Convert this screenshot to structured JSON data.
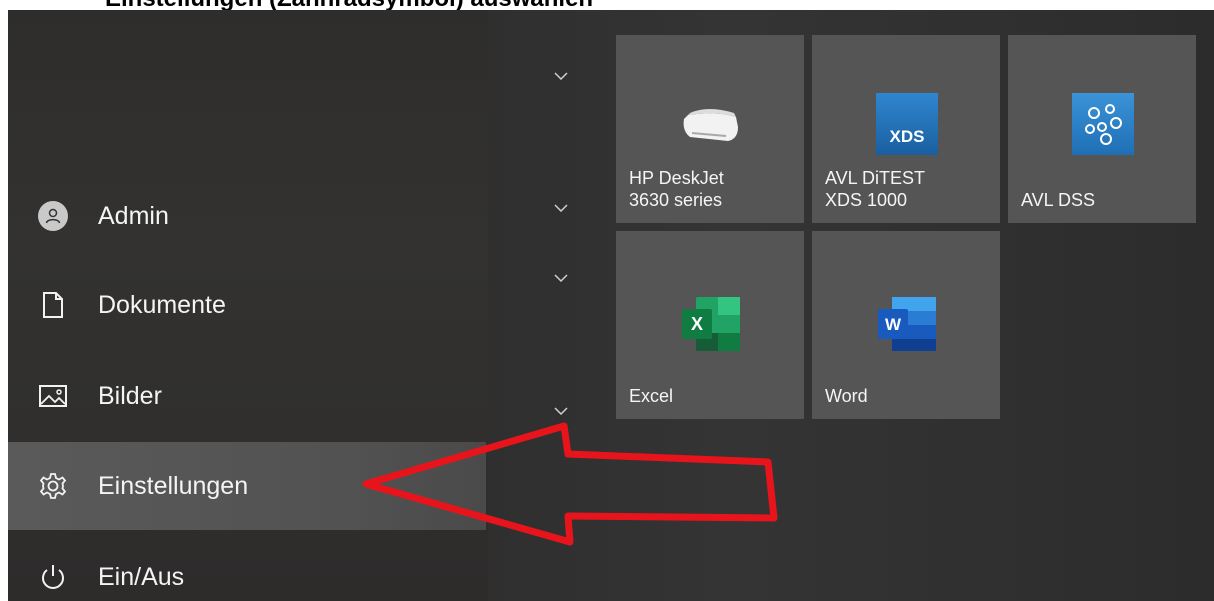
{
  "caption": "Einstellungen (Zahnradsymbol) auswählen",
  "menu": {
    "items": [
      {
        "label": "Admin",
        "icon": "user-avatar-icon"
      },
      {
        "label": "Dokumente",
        "icon": "document-icon"
      },
      {
        "label": "Bilder",
        "icon": "pictures-icon"
      },
      {
        "label": "Einstellungen",
        "icon": "gear-icon",
        "highlighted": true
      },
      {
        "label": "Ein/Aus",
        "icon": "power-icon"
      }
    ]
  },
  "tiles": [
    {
      "label": "HP DeskJet\n3630 series",
      "icon": "printer-icon"
    },
    {
      "label": "AVL DiTEST\nXDS 1000",
      "icon": "xds-logo-icon",
      "icon_text": "XDS"
    },
    {
      "label": "AVL DSS",
      "icon": "avl-dss-logo-icon"
    },
    {
      "label": "Excel",
      "icon": "excel-icon",
      "icon_text": "X"
    },
    {
      "label": "Word",
      "icon": "word-icon",
      "icon_text": "W"
    }
  ],
  "group_chevrons": [
    "chevron-down-icon",
    "chevron-down-icon",
    "chevron-down-icon",
    "chevron-down-icon"
  ],
  "colors": {
    "annotation_arrow": "#e8141c",
    "tile_bg": "#555556",
    "highlight_bg": "#555555",
    "excel_green": "#1d6f42",
    "word_blue": "#2b579a",
    "xds_blue": "#1f6fb5"
  }
}
